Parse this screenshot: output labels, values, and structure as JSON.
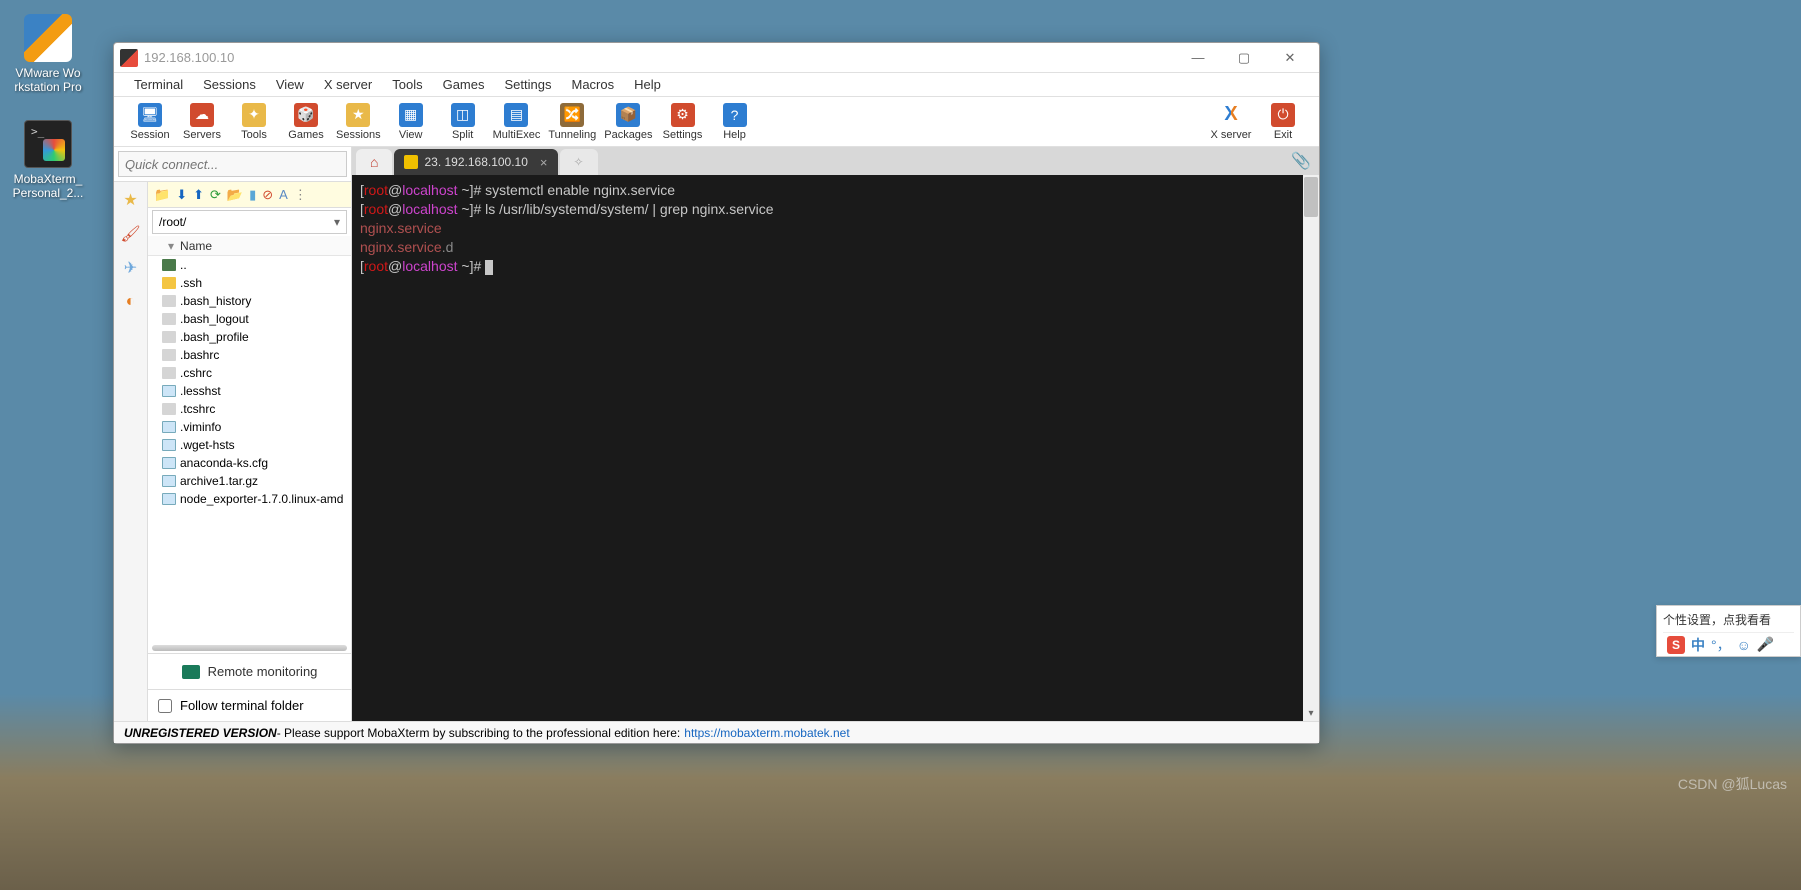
{
  "desktop": {
    "icons": [
      {
        "name": "vmware-workstation-icon",
        "label": "VMware Wo\nrkstation Pro"
      },
      {
        "name": "mobaxterm-icon",
        "label": "MobaXterm_\nPersonal_2..."
      }
    ]
  },
  "window": {
    "title": "192.168.100.10",
    "menu": [
      "Terminal",
      "Sessions",
      "View",
      "X server",
      "Tools",
      "Games",
      "Settings",
      "Macros",
      "Help"
    ],
    "toolbar": [
      {
        "label": "Session",
        "name": "session-button",
        "color": "#2e7dd1",
        "glyph": "🖥"
      },
      {
        "label": "Servers",
        "name": "servers-button",
        "color": "#d14b2e",
        "glyph": "☁"
      },
      {
        "label": "Tools",
        "name": "tools-button",
        "color": "#e9b949",
        "glyph": "✦"
      },
      {
        "label": "Games",
        "name": "games-button",
        "color": "#d14b2e",
        "glyph": "🎲"
      },
      {
        "label": "Sessions",
        "name": "sessions-button",
        "color": "#e9b949",
        "glyph": "★"
      },
      {
        "label": "View",
        "name": "view-button",
        "color": "#2e7dd1",
        "glyph": "▦"
      },
      {
        "label": "Split",
        "name": "split-button",
        "color": "#2e7dd1",
        "glyph": "◫"
      },
      {
        "label": "MultiExec",
        "name": "multiexec-button",
        "color": "#2e7dd1",
        "glyph": "▤"
      },
      {
        "label": "Tunneling",
        "name": "tunneling-button",
        "color": "#8e6b3a",
        "glyph": "🔀"
      },
      {
        "label": "Packages",
        "name": "packages-button",
        "color": "#2e7dd1",
        "glyph": "📦"
      },
      {
        "label": "Settings",
        "name": "settings-button",
        "color": "#d14b2e",
        "glyph": "⚙"
      },
      {
        "label": "Help",
        "name": "help-button",
        "color": "#2e7dd1",
        "glyph": "?"
      }
    ],
    "toolbar_right": [
      {
        "label": "X server",
        "name": "xserver-button",
        "letter": "X"
      },
      {
        "label": "Exit",
        "name": "exit-button",
        "color": "#d14b2e",
        "glyph": "⏻"
      }
    ],
    "quick_connect_placeholder": "Quick connect...",
    "path": "/root/",
    "file_header": "Name",
    "files": [
      {
        "label": "..",
        "type": "up"
      },
      {
        "label": ".ssh",
        "type": "folder"
      },
      {
        "label": ".bash_history",
        "type": "file"
      },
      {
        "label": ".bash_logout",
        "type": "file"
      },
      {
        "label": ".bash_profile",
        "type": "file"
      },
      {
        "label": ".bashrc",
        "type": "file"
      },
      {
        "label": ".cshrc",
        "type": "file"
      },
      {
        "label": ".lesshst",
        "type": "doc"
      },
      {
        "label": ".tcshrc",
        "type": "file"
      },
      {
        "label": ".viminfo",
        "type": "doc"
      },
      {
        "label": ".wget-hsts",
        "type": "doc"
      },
      {
        "label": "anaconda-ks.cfg",
        "type": "doc"
      },
      {
        "label": "archive1.tar.gz",
        "type": "doc"
      },
      {
        "label": "node_exporter-1.7.0.linux-amd",
        "type": "doc"
      }
    ],
    "remote_monitoring": "Remote monitoring",
    "follow_terminal": "Follow terminal folder",
    "tabs": {
      "active_label": "23. 192.168.100.10"
    },
    "terminal": {
      "line1_cmd": "systemctl enable nginx.service",
      "line2_cmd": "ls /usr/lib/systemd/system/ | grep nginx.service",
      "out1": "nginx.service",
      "out2a": "nginx.service",
      "out2b": ".d",
      "prompt_root": "root",
      "prompt_at": "@",
      "prompt_host": "localhost",
      "prompt_tail": " ~]# "
    },
    "statusbar": {
      "unreg": "UNREGISTERED VERSION",
      "msg": "  -  Please support MobaXterm by subscribing to the professional edition here:  ",
      "link": "https://mobaxterm.mobatek.net"
    }
  },
  "floating": {
    "text": "个性设置，点我看看",
    "ime_label": "中"
  },
  "watermark": "CSDN @狐Lucas"
}
